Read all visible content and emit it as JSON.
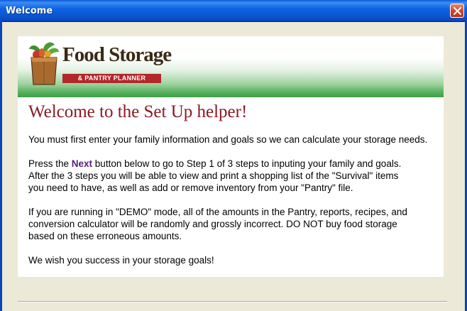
{
  "window": {
    "title": "Welcome"
  },
  "logo": {
    "line1": "Food Storage",
    "line2": "& PANTRY PLANNER"
  },
  "heading": "Welcome to the Set Up helper!",
  "paragraphs": {
    "p1": "You must first enter your family information and goals so we can calculate your storage needs.",
    "p2_before": "Press the ",
    "p2_next": "Next",
    "p2_line1_after": " button below to go to Step 1 of 3 steps to inputing your family and goals.",
    "p2_line2": "After the 3 steps you will be able to view and print a shopping list of the \"Survival\" items",
    "p2_line3": "you need to have, as well as add or remove inventory from your \"Pantry\" file.",
    "p3_line1": "If you are running in \"DEMO\" mode, all of the amounts in the Pantry, reports, recipes, and",
    "p3_line2": "conversion calculator will be randomly and grossly incorrect. DO NOT buy food storage",
    "p3_line3": "based on these erroneous amounts.",
    "p4": "We wish you success in your storage goals!"
  },
  "colors": {
    "titlebar": "#0a55d2",
    "heading": "#8b1a24",
    "next_link": "#5a1a78",
    "banner_green": "#3f9e4a",
    "logo_red": "#b3262a"
  },
  "icons": {
    "close": "close-icon",
    "logo": "grocery-bag-icon"
  }
}
